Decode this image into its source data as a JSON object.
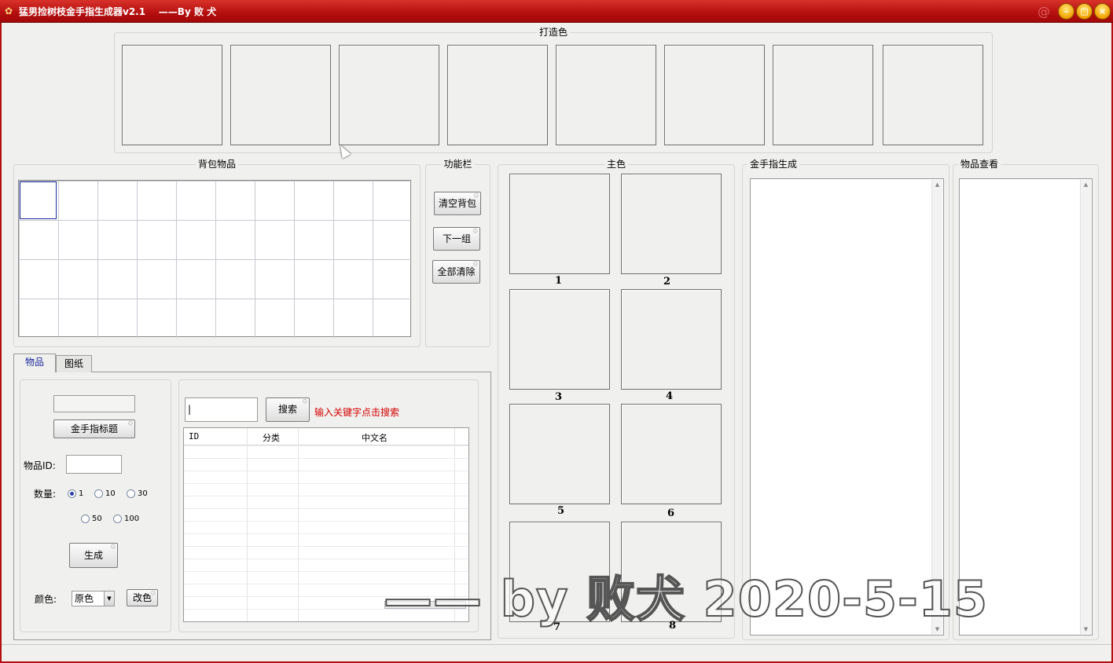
{
  "window": {
    "title": "猛男捡树枝金手指生成器v2.1    ——By 败 犬",
    "controls": [
      "–",
      "□",
      "×"
    ]
  },
  "forge_colors": {
    "title": "打造色",
    "slots": 8
  },
  "backpack": {
    "title": "背包物品",
    "rows": 4,
    "cols": 10
  },
  "function_bar": {
    "title": "功能栏",
    "buttons": [
      "清空背包",
      "下一组",
      "全部清除"
    ]
  },
  "main_color": {
    "title": "主色",
    "slot_labels": [
      "1",
      "2",
      "3",
      "4",
      "5",
      "6",
      "7",
      "8"
    ]
  },
  "cheat_gen": {
    "title": "金手指生成"
  },
  "item_view": {
    "title": "物品查看"
  },
  "tabs": [
    "物品",
    "图纸"
  ],
  "item_panel": {
    "title_input_value": "",
    "title_button": "金手指标题",
    "item_id_label": "物品ID:",
    "item_id_value": "",
    "quantity_label": "数量:",
    "quantity_options": [
      "1",
      "10",
      "30",
      "50",
      "100"
    ],
    "quantity_selected": "1",
    "generate_button": "生成",
    "color_label": "颜色:",
    "color_value": "原色",
    "recolor_button": "改色"
  },
  "search": {
    "input_value": "|",
    "button": "搜索",
    "hint": "输入关键字点击搜索",
    "hint_color": "#d40000",
    "columns": [
      "ID",
      "分类",
      "中文名"
    ]
  },
  "watermark": "—— by  败犬  2020-5-15"
}
